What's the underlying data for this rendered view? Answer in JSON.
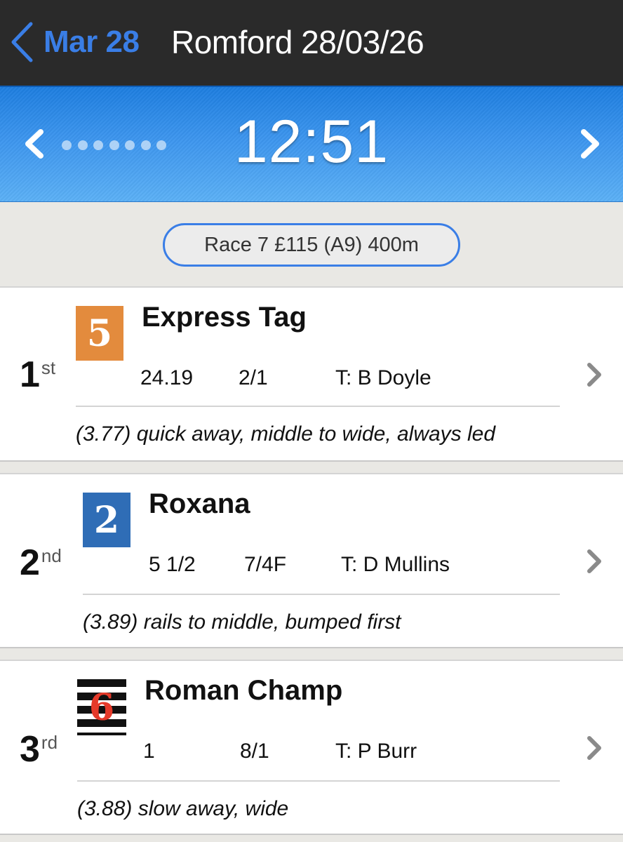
{
  "nav": {
    "back_label": "Mar 28",
    "title": "Romford 28/03/26"
  },
  "race_header": {
    "time": "12:51",
    "dots_count": 7
  },
  "race_info": "Race 7 £115 (A9) 400m",
  "colors": {
    "nav_bg": "#2a2a2a",
    "accent_blue": "#3a7ee6",
    "header_blue": "#3c95ee",
    "trap1": "#e38b3d",
    "trap2": "#2f6db6",
    "trap3_stripe": "#111111",
    "trap3_number": "#e53a2a"
  },
  "runners": [
    {
      "place_num": "1",
      "place_suffix": "st",
      "trap": "5",
      "trap_icon": "trap-5-orange",
      "name": "Express Tag",
      "time_or_distance": "24.19",
      "odds": "2/1",
      "trainer": "T: B Doyle",
      "comment": "(3.77) quick away, middle to wide, always led"
    },
    {
      "place_num": "2",
      "place_suffix": "nd",
      "trap": "2",
      "trap_icon": "trap-2-blue",
      "name": "Roxana",
      "time_or_distance": "5 1/2",
      "odds": "7/4F",
      "trainer": "T: D Mullins",
      "comment": "(3.89) rails to middle, bumped first"
    },
    {
      "place_num": "3",
      "place_suffix": "rd",
      "trap": "6",
      "trap_icon": "trap-6-striped",
      "name": "Roman Champ",
      "time_or_distance": "1",
      "odds": "8/1",
      "trainer": "T: P Burr",
      "comment": "(3.88) slow away, wide"
    }
  ]
}
